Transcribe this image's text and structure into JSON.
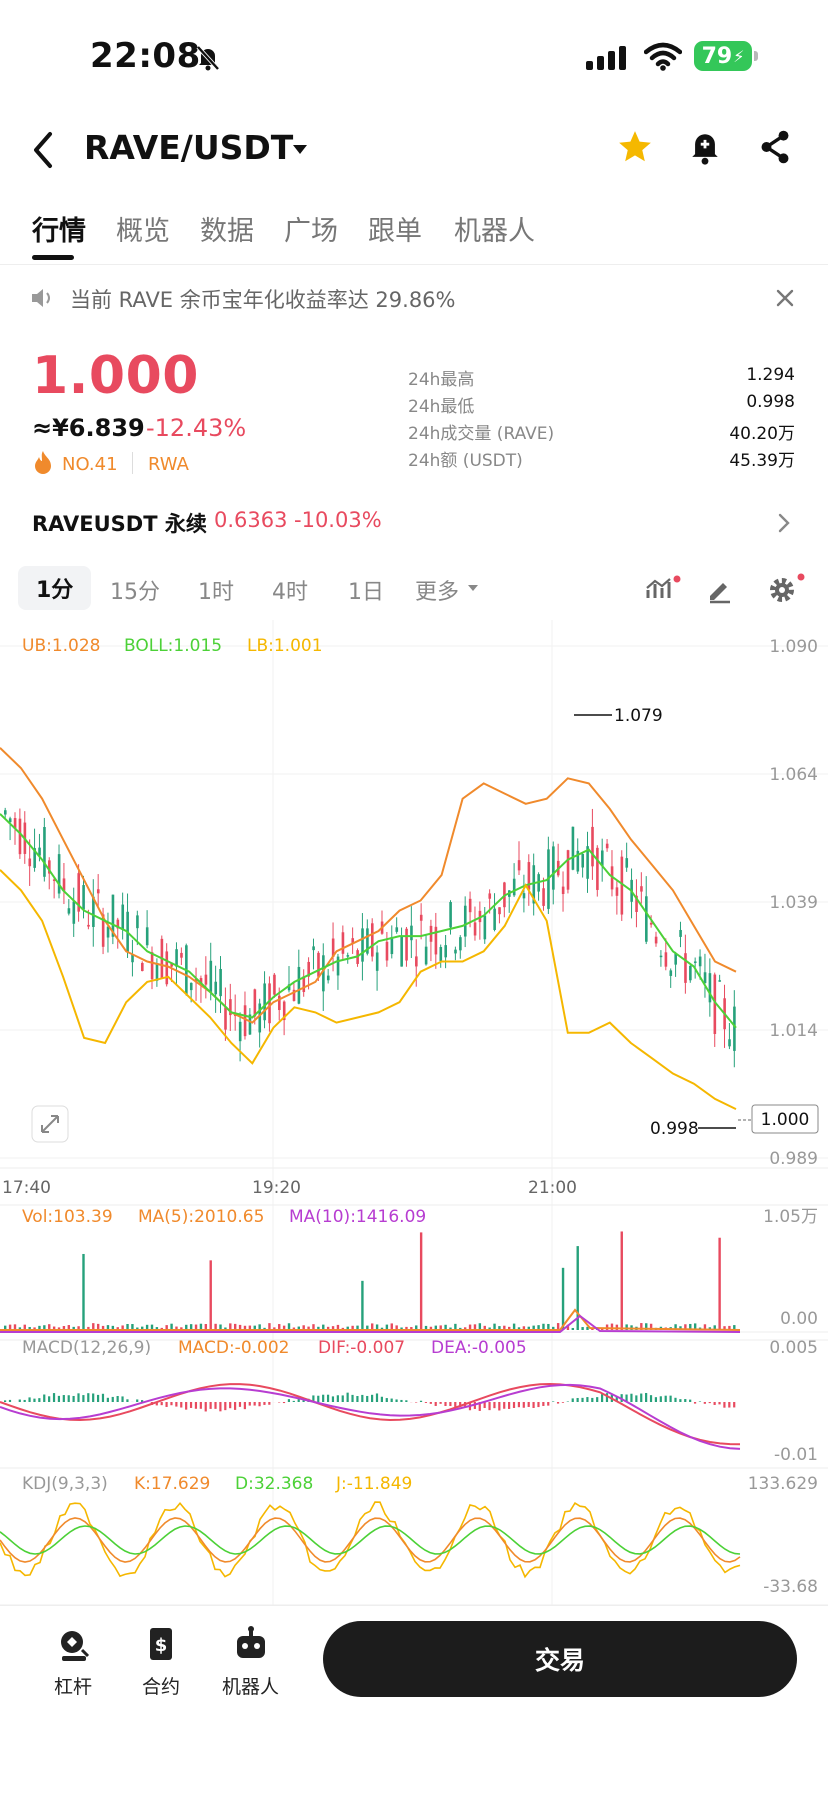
{
  "status_bar": {
    "time": "22:08",
    "battery": "79"
  },
  "header": {
    "pair": "RAVE/USDT"
  },
  "tabs": [
    "行情",
    "概览",
    "数据",
    "广场",
    "跟单",
    "机器人"
  ],
  "notice": {
    "text": "当前 RAVE 余币宝年化收益率达 29.86%"
  },
  "ticker": {
    "price": "1.000",
    "cny_price": "≈¥6.839",
    "change_pct": "-12.43%",
    "rank": "NO.41",
    "tag": "RWA",
    "stats": [
      {
        "label": "24h最高",
        "value": "1.294"
      },
      {
        "label": "24h最低",
        "value": "0.998"
      },
      {
        "label": "24h成交量 (RAVE)",
        "value": "40.20万"
      },
      {
        "label": "24h额 (USDT)",
        "value": "45.39万"
      }
    ]
  },
  "perpetual": {
    "name": "RAVEUSDT 永续",
    "price": "0.6363",
    "change": "-10.03%"
  },
  "timeframes": [
    "1分",
    "15分",
    "1时",
    "4时",
    "1日",
    "更多"
  ],
  "colors": {
    "up": "#26a17b",
    "down": "#e84a5f",
    "accent": "#f08a2c",
    "boll_mid": "#4cd137",
    "lb": "#f5b700"
  },
  "chart_data": {
    "type": "line",
    "boll_legend": {
      "ub": "UB:1.028",
      "boll": "BOLL:1.015",
      "lb": "LB:1.001"
    },
    "price_axis": [
      "1.090",
      "1.064",
      "1.039",
      "1.014",
      "0.989"
    ],
    "time_axis": [
      "17:40",
      "19:20",
      "21:00"
    ],
    "ylim": [
      0.989,
      1.09
    ],
    "high_marker": "1.079",
    "low_marker": "0.998",
    "last_price": "1.000",
    "boll_upper": [
      1.07,
      1.066,
      1.06,
      1.052,
      1.044,
      1.036,
      1.03,
      1.028,
      1.027,
      1.025,
      1.022,
      1.018,
      1.016,
      1.02,
      1.022,
      1.024,
      1.03,
      1.032,
      1.034,
      1.038,
      1.04,
      1.045,
      1.06,
      1.063,
      1.061,
      1.059,
      1.06,
      1.064,
      1.063,
      1.058,
      1.052,
      1.047,
      1.042,
      1.035,
      1.028,
      1.026
    ],
    "boll_mid": [
      1.057,
      1.053,
      1.048,
      1.042,
      1.038,
      1.036,
      1.034,
      1.03,
      1.028,
      1.026,
      1.022,
      1.018,
      1.017,
      1.021,
      1.024,
      1.026,
      1.028,
      1.029,
      1.032,
      1.033,
      1.033,
      1.034,
      1.035,
      1.037,
      1.041,
      1.043,
      1.044,
      1.048,
      1.05,
      1.045,
      1.042,
      1.036,
      1.03,
      1.027,
      1.02,
      1.015
    ],
    "boll_lower": [
      1.046,
      1.042,
      1.036,
      1.025,
      1.013,
      1.012,
      1.02,
      1.024,
      1.025,
      1.021,
      1.017,
      1.012,
      1.008,
      1.015,
      1.019,
      1.018,
      1.016,
      1.017,
      1.018,
      1.02,
      1.026,
      1.028,
      1.028,
      1.03,
      1.035,
      1.043,
      1.036,
      1.014,
      1.014,
      1.016,
      1.012,
      1.009,
      1.006,
      1.004,
      1.001,
      0.999
    ],
    "vol_legend": {
      "vol": "Vol:103.39",
      "ma5": "MA(5):2010.65",
      "ma10": "MA(10):1416.09"
    },
    "vol_axis": [
      "1.05万",
      "0.00"
    ],
    "macd_legend": {
      "title": "MACD(12,26,9)",
      "macd": "MACD:-0.002",
      "dif": "DIF:-0.007",
      "dea": "DEA:-0.005"
    },
    "macd_axis": [
      "0.005",
      "-0.01"
    ],
    "kdj_legend": {
      "title": "KDJ(9,3,3)",
      "k": "K:17.629",
      "d": "D:32.368",
      "j": "J:-11.849"
    },
    "kdj_axis": [
      "133.629",
      "-33.68"
    ]
  },
  "bottom_bar": {
    "items": [
      "杠杆",
      "合约",
      "机器人"
    ],
    "trade_label": "交易"
  }
}
